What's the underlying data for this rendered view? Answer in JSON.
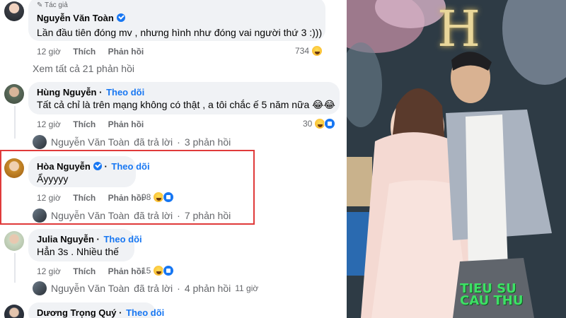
{
  "comments": [
    {
      "author_tag": "Tác giả",
      "name": "Nguyễn Văn Toàn",
      "verified": true,
      "text": "Lần đầu tiên đóng mv , nhưng hình như đóng vai người thứ 3 :)))",
      "time": "12 giờ",
      "like_label": "Thích",
      "reply_label": "Phản hồi",
      "reaction_count": "734"
    },
    {
      "name": "Hùng Nguyễn",
      "follow_label": "Theo dõi",
      "text": "Tất cả chỉ là trên mạng không có thật , a tôi chắc ế 5 năm nữa 😂😂",
      "time": "12 giờ",
      "like_label": "Thích",
      "reply_label": "Phản hồi",
      "reaction_count": "30",
      "replies": {
        "name": "Nguyễn Văn Toàn",
        "action": "đã trả lời",
        "count": "3 phản hồi"
      }
    },
    {
      "name": "Hòa Nguyễn",
      "verified": true,
      "follow_label": "Theo dõi",
      "text": "Ẩyyyyy",
      "time": "12 giờ",
      "like_label": "Thích",
      "reply_label": "Phản hồi",
      "reaction_count": "98",
      "replies": {
        "name": "Nguyễn Văn Toàn",
        "action": "đã trả lời",
        "count": "7 phản hồi"
      }
    },
    {
      "name": "Julia Nguyễn",
      "follow_label": "Theo dõi",
      "text": "Hẳn 3s . Nhiều thế",
      "time": "12 giờ",
      "like_label": "Thích",
      "reply_label": "Phản hồi",
      "reaction_count": "15",
      "replies": {
        "name": "Nguyễn Văn Toàn",
        "action": "đã trả lời",
        "count": "4 phản hồi",
        "time": "11 giờ"
      }
    },
    {
      "name": "Dương Trọng Quý",
      "follow_label": "Theo dõi"
    }
  ],
  "see_all_replies": "Xem tất cả 21 phản hồi",
  "photo": {
    "logo_line1": "TIEU SU",
    "logo_line2": "CAU THU"
  },
  "colors": {
    "link_blue": "#1877f2",
    "highlight_red": "#e03a3a",
    "bubble_gray": "#f0f2f5",
    "logo_green": "#3ee065"
  }
}
